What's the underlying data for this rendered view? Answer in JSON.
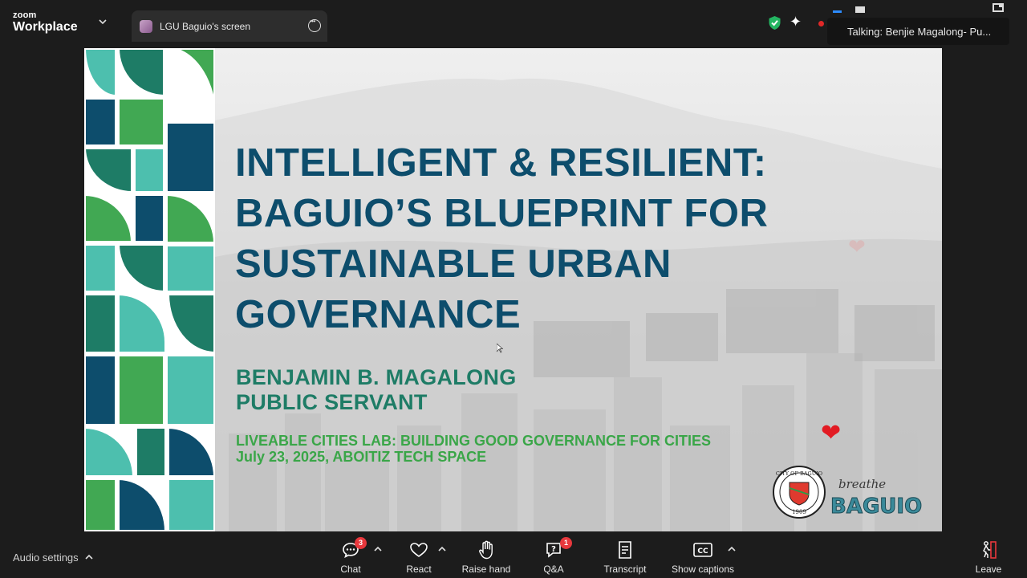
{
  "app": {
    "logo_line1": "zoom",
    "logo_line2": "Workplace"
  },
  "share_tab": {
    "title": "LGU Baguio's screen"
  },
  "status": {
    "talking": "Talking: Benjie Magalong- Pu..."
  },
  "slide": {
    "title_lines": [
      "INTELLIGENT & RESILIENT:",
      "BAGUIO’S BLUEPRINT FOR",
      "SUSTAINABLE URBAN",
      "GOVERNANCE"
    ],
    "speaker_name": "BENJAMIN B. MAGALONG",
    "speaker_role": "PUBLIC SERVANT",
    "event_name": "LIVEABLE CITIES LAB: BUILDING GOOD GOVERNANCE FOR CITIES",
    "event_date_place": "July 23, 2025, ABOITIZ TECH SPACE",
    "seal_top": "CITY OF BAGUIO",
    "seal_year": "1909",
    "logo_script": "breathe",
    "logo_word": "BAGUIO"
  },
  "toolbar": {
    "audio_settings": "Audio settings",
    "chat": "Chat",
    "chat_badge": "3",
    "react": "React",
    "raise_hand": "Raise hand",
    "qa": "Q&A",
    "qa_badge": "1",
    "transcript": "Transcript",
    "show_captions": "Show captions",
    "leave": "Leave"
  },
  "colors": {
    "title": "#0d4d6c",
    "name": "#1e7c66",
    "event": "#3aa648",
    "badge": "#e8383d"
  }
}
